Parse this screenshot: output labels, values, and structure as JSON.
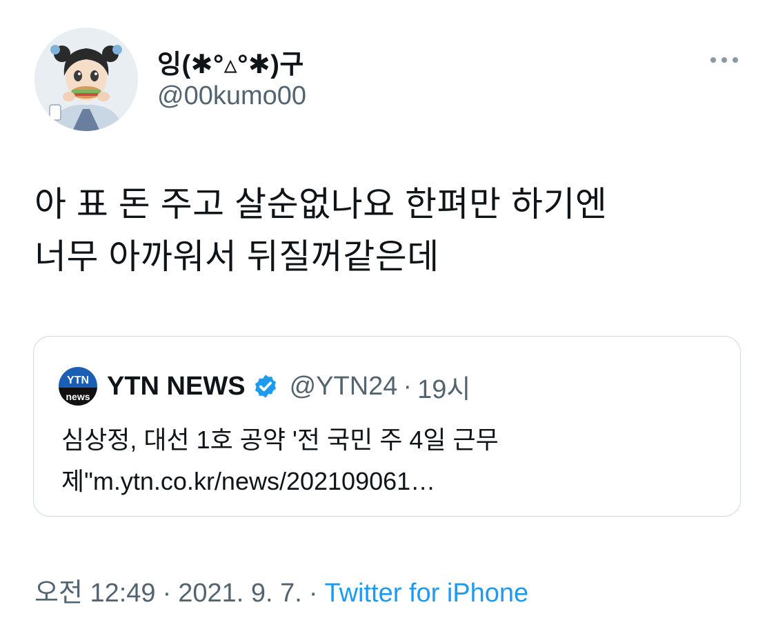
{
  "author": {
    "display_name": "잉(✱°▵°✱)구",
    "handle": "@00kumo00",
    "avatar_icon": "anime-girl-eating-avatar"
  },
  "more_icon": "more-horizontal-icon",
  "tweet": {
    "text": "아 표 돈 주고 살순없나요 한펴만 하기엔\n너무 아까워서 뒤질꺼같은데"
  },
  "quoted_tweet": {
    "logo_top": "YTN",
    "logo_bottom": "news",
    "name": "YTN NEWS",
    "verified_icon": "verified-badge-icon",
    "handle": "@YTN24",
    "separator": "·",
    "time": "19시",
    "text": "심상정, 대선 1호 공약 '전 국민 주 4일 근무\n제\"m.ytn.co.kr/news/202109061…"
  },
  "meta": {
    "time": "오전 12:49",
    "separator": "·",
    "date": "2021. 9. 7.",
    "separator2": "·",
    "source": "Twitter for iPhone"
  },
  "colors": {
    "text_primary": "#0f1419",
    "text_secondary": "#536471",
    "link": "#1d9bf0",
    "border": "#cfd9de",
    "ytn_blue": "#1a5fb4"
  }
}
